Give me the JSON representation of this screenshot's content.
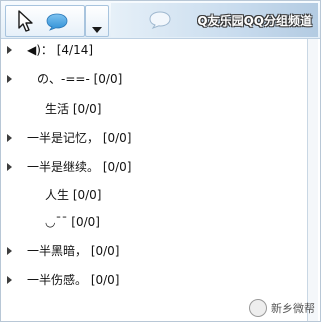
{
  "toolbar": {
    "title": "Q友乐园QQ分组频道",
    "pointer_icon": "cursor-pointer-icon",
    "chat_icon": "chat-bubble-icon",
    "dropdown_icon": "triangle-down-icon",
    "chat_icon_2": "chat-bubble-outline-icon"
  },
  "tree": {
    "rows": [
      {
        "label": "◀)：  [4/14]",
        "has_caret": true
      },
      {
        "label": "の、-==-  [0/0]",
        "has_caret": true
      },
      {
        "label": "生活  [0/0]",
        "has_caret": false
      },
      {
        "label": "一半是记忆，  [0/0]",
        "has_caret": true
      },
      {
        "label": "一半是继续。   [0/0]",
        "has_caret": true
      },
      {
        "label": "人生  [0/0]",
        "has_caret": false
      },
      {
        "label": "◡¯¯  [0/0]",
        "has_caret": false
      },
      {
        "label": "一半黑暗，  [0/0]",
        "has_caret": true
      },
      {
        "label": "一半伤感。  [0/0]",
        "has_caret": true
      }
    ]
  },
  "watermark": {
    "text": "新乡微帮",
    "icon": "wechat-logo-icon"
  },
  "colors": {
    "toolbar_bg": "#e3eef7",
    "border": "#b8c7d6",
    "caret": "#3d3d3d",
    "title_text": "#ffffff"
  }
}
